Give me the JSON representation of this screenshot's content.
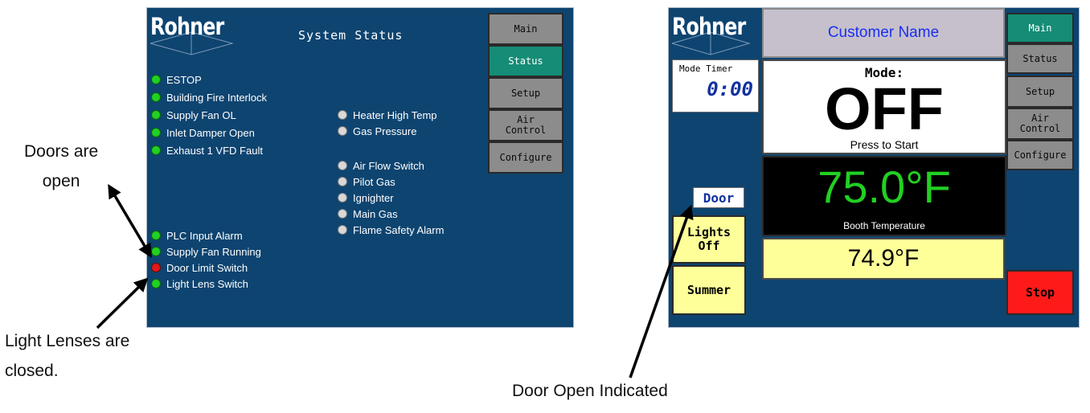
{
  "left_screen": {
    "brand": "Rohner",
    "title": "System Status",
    "nav": [
      "Main",
      "Status",
      "Setup",
      "Air\nControl",
      "Configure"
    ],
    "active_nav": "Status",
    "status_left": [
      {
        "label": "ESTOP",
        "state": "green"
      },
      {
        "label": "Building Fire Interlock",
        "state": "green"
      },
      {
        "label": "Supply Fan OL",
        "state": "green"
      },
      {
        "label": "Inlet Damper Open",
        "state": "green"
      },
      {
        "label": "Exhaust 1 VFD Fault",
        "state": "green"
      },
      {
        "label": "PLC Input Alarm",
        "state": "green"
      },
      {
        "label": "Supply Fan Running",
        "state": "green"
      },
      {
        "label": "Door Limit Switch",
        "state": "red"
      },
      {
        "label": "Light Lens Switch",
        "state": "green"
      }
    ],
    "status_right": [
      {
        "label": "Heater High Temp",
        "state": "gray"
      },
      {
        "label": "Gas Pressure",
        "state": "gray"
      },
      {
        "label": "Air Flow Switch",
        "state": "gray"
      },
      {
        "label": "Pilot Gas",
        "state": "gray"
      },
      {
        "label": "Ignighter",
        "state": "gray"
      },
      {
        "label": "Main Gas",
        "state": "gray"
      },
      {
        "label": "Flame Safety Alarm",
        "state": "gray"
      }
    ]
  },
  "right_screen": {
    "brand": "Rohner",
    "customer_name": "Customer Name",
    "nav": [
      "Main",
      "Status",
      "Setup",
      "Air\nControl",
      "Configure"
    ],
    "active_nav": "Main",
    "mode_timer_label": "Mode Timer",
    "mode_timer_value": "0:00",
    "mode_label": "Mode:",
    "mode_value": "OFF",
    "mode_hint": "Press to Start",
    "booth_temp": "75.0°F",
    "booth_temp_label": "Booth Temperature",
    "setpoint_temp": "74.9°F",
    "door_indicator": "Door",
    "lights_button": "Lights\nOff",
    "season_button": "Summer",
    "stop_button": "Stop"
  },
  "annotations": {
    "doors_open": "Doors are\nopen",
    "lenses_closed": "Light Lenses are\nclosed.",
    "door_open_indicated": "Door Open Indicated"
  },
  "colors": {
    "screen_bg": "#0e4470",
    "nav_gray": "#8c8c8c",
    "nav_active": "#158c76",
    "indicator_green": "#22d022",
    "indicator_red": "#e01818",
    "temp_green": "#22d022",
    "setpoint_yellow": "#ffff99",
    "stop_red": "#ff1a1a"
  }
}
